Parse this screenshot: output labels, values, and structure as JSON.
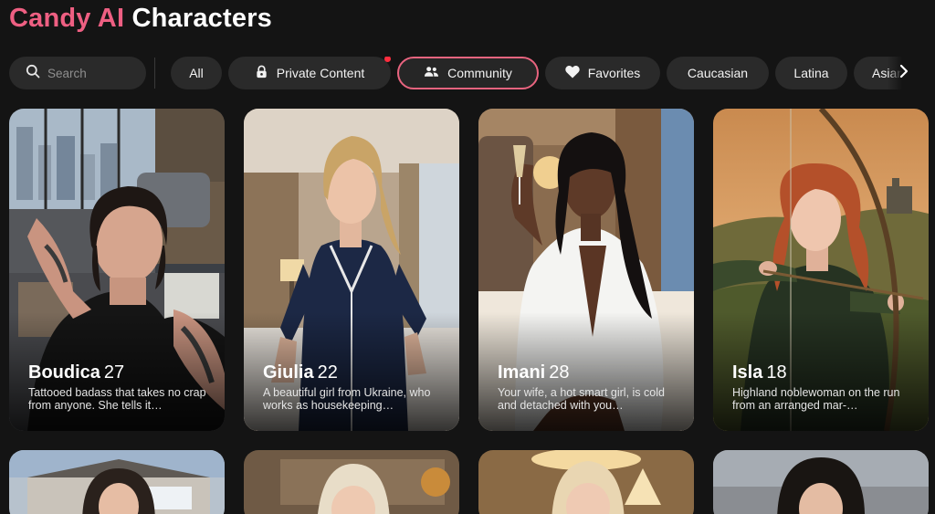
{
  "header": {
    "brand": "Candy AI",
    "title_rest": "Characters"
  },
  "search": {
    "placeholder": "Search"
  },
  "filters": {
    "all": "All",
    "private": "Private Content",
    "community": "Community",
    "favorites": "Favorites",
    "caucasian": "Caucasian",
    "latina": "Latina",
    "asian": "Asian"
  },
  "characters": [
    {
      "name": "Boudica",
      "age": "27",
      "desc": "Tattooed badass that takes no crap from anyone. She tells it…"
    },
    {
      "name": "Giulia",
      "age": "22",
      "desc": "A beautiful girl from Ukraine, who works as housekeeping…"
    },
    {
      "name": "Imani",
      "age": "28",
      "desc": "Your wife, a hot smart girl, is cold and detached with you…"
    },
    {
      "name": "Isla",
      "age": "18",
      "desc": "Highland noblewoman on the run from an arranged mar-…"
    }
  ],
  "colors": {
    "accent": "#ee5f82",
    "background": "#141414",
    "pill": "#2a2a2a",
    "notification": "#ff2d3e"
  },
  "icons": [
    "search-icon",
    "lock-icon",
    "users-icon",
    "heart-icon",
    "chevron-right-icon"
  ]
}
